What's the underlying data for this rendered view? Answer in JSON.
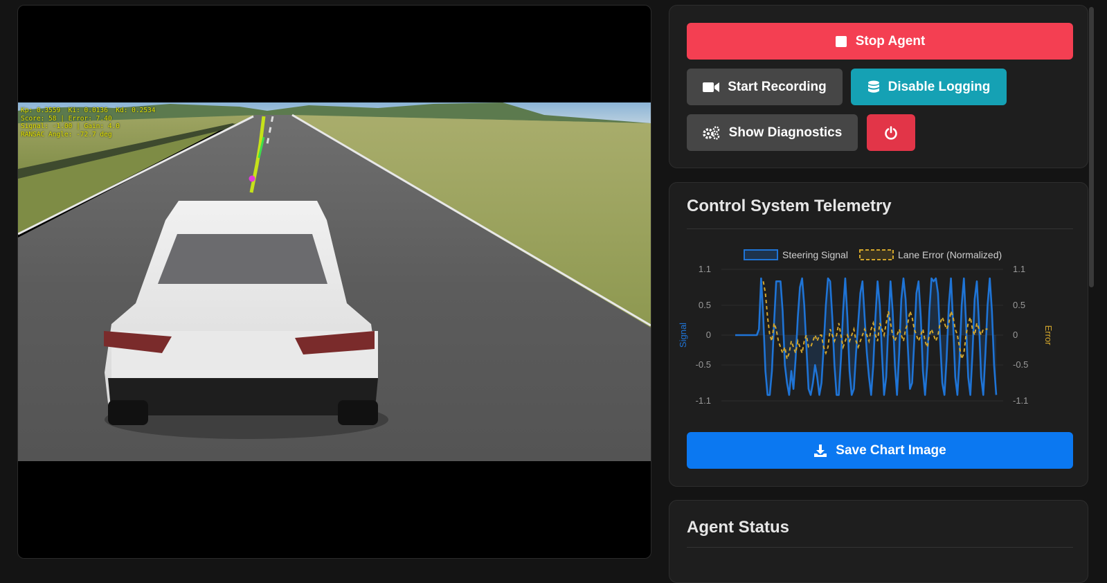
{
  "video": {
    "hud": [
      "Kp: 0.3559  Ki: 0.0136  Kd: 0.2534",
      "Score: 58 | Error: 7.40",
      "Signal: -1.00 | Gain: 4.0",
      "RANSAC Angle: -72.7 deg"
    ]
  },
  "controls": {
    "stop_label": "Stop Agent",
    "record_label": "Start Recording",
    "logging_label": "Disable Logging",
    "diagnostics_label": "Show Diagnostics",
    "stop_icon": "stop-square-icon",
    "record_icon": "video-camera-icon",
    "logging_icon": "database-icon",
    "diagnostics_icon": "gears-icon",
    "power_icon": "power-icon"
  },
  "telemetry": {
    "title": "Control System Telemetry",
    "save_label": "Save Chart Image",
    "save_icon": "download-icon"
  },
  "status": {
    "title": "Agent Status"
  },
  "colors": {
    "stop": "#f43f52",
    "logging": "#15a1b4",
    "power": "#e23548",
    "save": "#0b78f1",
    "signal": "#1f74d6",
    "error": "#d4a72c"
  },
  "chart_data": {
    "type": "line",
    "title": "",
    "legend": [
      "Steering Signal",
      "Lane Error (Normalized)"
    ],
    "legend_position": "top",
    "ylabel_left": "Signal",
    "ylabel_right": "Error",
    "ylim": [
      -1.1,
      1.1
    ],
    "yticks": [
      1.1,
      0.5,
      0,
      -0.5,
      -1.1
    ],
    "grid": true,
    "series": [
      {
        "name": "Steering Signal",
        "values": [
          0,
          0,
          0,
          0,
          0,
          0,
          0,
          0,
          0,
          0,
          0,
          0.1,
          0.95,
          0.3,
          -0.6,
          -1.0,
          -1.0,
          -0.6,
          0.2,
          0.9,
          0.9,
          0.9,
          0.4,
          -0.5,
          -0.8,
          -1.0,
          -0.6,
          -0.9,
          -0.4,
          0.3,
          0.8,
          0.95,
          0.5,
          -0.2,
          -0.9,
          -1.0,
          -0.8,
          -0.5,
          -0.7,
          -1.0,
          -0.8,
          -0.2,
          0.5,
          0.95,
          0.9,
          0.3,
          -0.5,
          -1.0,
          -1.0,
          -0.4,
          0.4,
          0.95,
          0.3,
          -0.6,
          -1.0,
          -0.9,
          -0.3,
          0.2,
          0.7,
          0.9,
          0.3,
          -0.3,
          -0.7,
          -1.0,
          -0.5,
          0.3,
          0.9,
          0.5,
          -0.3,
          -1.0,
          -0.7,
          0.2,
          0.9,
          0.4,
          -0.5,
          -1.0,
          -0.3,
          0.6,
          0.95,
          0.6,
          -0.2,
          -0.9,
          -0.8,
          -0.1,
          0.7,
          0.9,
          0.3,
          -0.6,
          -1.0,
          -0.5,
          0.4,
          0.95,
          0.9,
          0.95,
          0.7,
          -0.1,
          -0.8,
          -1.0,
          -0.4,
          0.5,
          0.95,
          0.2,
          -0.7,
          -1.0,
          -0.4,
          0.5,
          0.95,
          0.2,
          -0.7,
          -1.0,
          -0.3,
          0.6,
          0.9,
          0.2,
          -0.7,
          -1.0,
          -0.3,
          0.5,
          0.95,
          0.4,
          -0.5,
          -1.0
        ]
      },
      {
        "name": "Lane Error (Normalized)",
        "values": [
          null,
          null,
          null,
          null,
          null,
          null,
          null,
          null,
          null,
          null,
          null,
          null,
          null,
          0.9,
          0.7,
          0.3,
          0.0,
          -0.1,
          0.2,
          0.1,
          -0.1,
          -0.2,
          -0.3,
          -0.2,
          -0.4,
          -0.3,
          -0.1,
          -0.2,
          -0.3,
          -0.1,
          -0.2,
          -0.3,
          -0.1,
          0.0,
          -0.2,
          -0.2,
          -0.1,
          0.0,
          -0.1,
          0.0,
          0.0,
          -0.2,
          -0.3,
          -0.2,
          0.1,
          0.0,
          -0.1,
          0.0,
          0.2,
          0.0,
          -0.2,
          -0.1,
          0.0,
          -0.1,
          0.0,
          0.1,
          -0.1,
          -0.2,
          -0.1,
          0.0,
          0.1,
          0.0,
          -0.1,
          0.1,
          0.2,
          0.0,
          -0.1,
          0.2,
          0.1,
          0.0,
          0.2,
          0.4,
          0.2,
          0.0,
          -0.1,
          0.0,
          0.1,
          0.0,
          -0.1,
          0.1,
          0.2,
          0.4,
          0.3,
          0.1,
          0.0,
          -0.1,
          0.0,
          0.1,
          -0.1,
          -0.2,
          0.0,
          0.1,
          0.0,
          -0.1,
          0.0,
          0.2,
          0.3,
          0.2,
          0.1,
          0.2,
          0.4,
          0.3,
          0.1,
          0.0,
          -0.2,
          -0.4,
          -0.3,
          0.0,
          0.2,
          0.3,
          0.1,
          0.0,
          0.2,
          0.1,
          0.0,
          0.1,
          0.1,
          0.1
        ]
      }
    ]
  }
}
